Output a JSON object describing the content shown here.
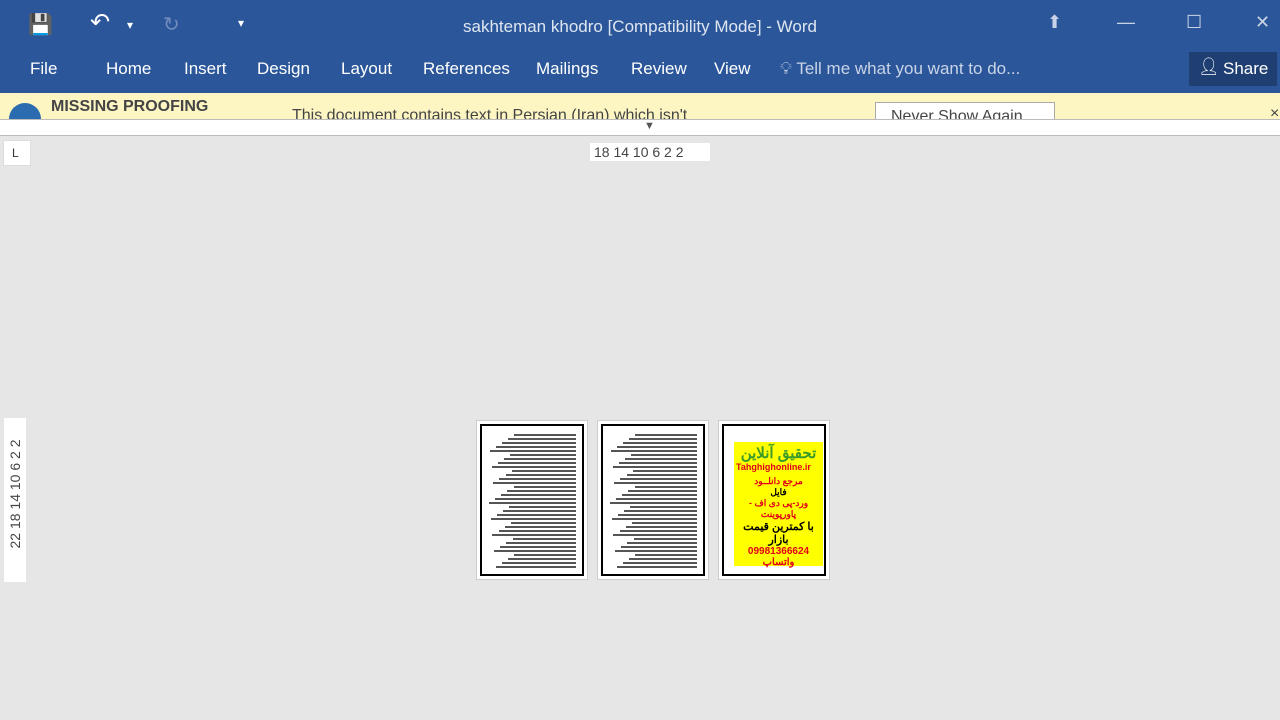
{
  "window": {
    "title": "sakhteman khodro [Compatibility Mode] - Word"
  },
  "qat": {
    "save": "💾",
    "undo": "↶",
    "undo_menu": "▾",
    "redo": "↻",
    "customize": "▾"
  },
  "ribbon": {
    "tabs": [
      "File",
      "Home",
      "Insert",
      "Design",
      "Layout",
      "References",
      "Mailings",
      "Review",
      "View"
    ],
    "tell_me": "Tell me what you want to do...",
    "share": "Share"
  },
  "message_bar": {
    "title": "MISSING PROOFING",
    "text": "This document contains text in Persian (Iran) which isn't",
    "button": "Never Show Again",
    "close": "×"
  },
  "ruler": {
    "horizontal": "18 14 10  6   2   2",
    "vertical": "22 18 14 10  6  2   2",
    "tab_selector": "L"
  },
  "ad": {
    "title": "تحقیق آنلاین",
    "site": "Tahghighonline.ir",
    "l1": "مرجع دانلــود",
    "l2": "فایل",
    "l3": "ورد-پی دی اف - پاورپوینت",
    "l4": "با کمترین قیمت بازار",
    "l5": "09981366624 واتساپ"
  },
  "colors": {
    "accent": "#2b579a",
    "message_bar": "#fdf6c3",
    "canvas": "#e6e6e6"
  }
}
